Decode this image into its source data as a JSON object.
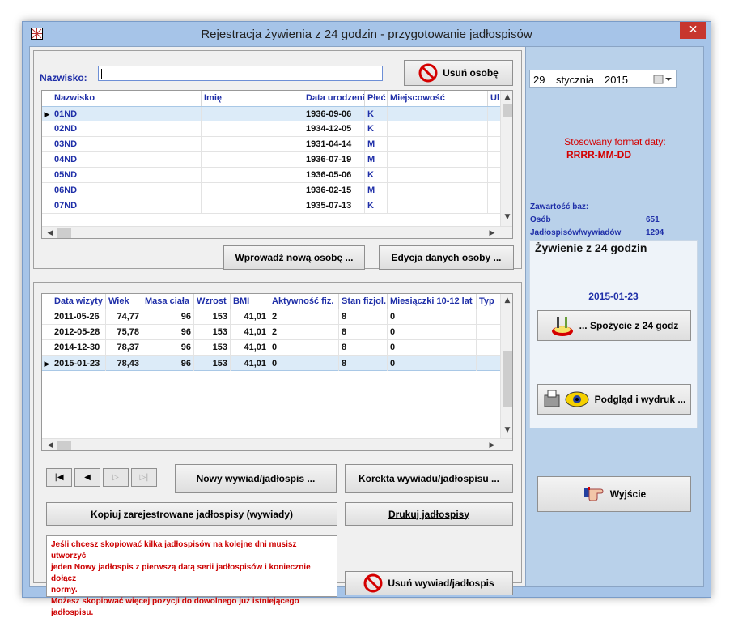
{
  "window": {
    "title": "Rejestracja żywienia z 24 godzin - przygotowanie jadłospisów",
    "close_glyph": "✕"
  },
  "search": {
    "label": "Nazwisko:",
    "value": ""
  },
  "buttons": {
    "delete_person": "Usuń osobę",
    "new_person": "Wprowadź nową osobę ...",
    "edit_person": "Edycja danych osoby ...",
    "new_interview": "Nowy wywiad/jadłospis ...",
    "correct_interview": "Korekta wywiadu/jadłospisu ...",
    "copy_interviews": "Kopiuj zarejestrowane jadłospisy (wywiady)",
    "print_menus": "Drukuj jadłospisy",
    "delete_interview": "Usuń wywiad/jadłospis",
    "intake_24h": "... Spożycie z 24 godz",
    "preview_print": "Podgląd i wydruk ...",
    "exit": "Wyjście"
  },
  "persons_grid": {
    "columns": [
      "Nazwisko",
      "Imię",
      "Data urodzenia",
      "Płeć",
      "Miejscowość",
      "Ul"
    ],
    "rows": [
      {
        "nazwisko": "01ND",
        "imie": "",
        "data": "1936-09-06",
        "plec": "K",
        "miejscowosc": ""
      },
      {
        "nazwisko": "02ND",
        "imie": "",
        "data": "1934-12-05",
        "plec": "K",
        "miejscowosc": ""
      },
      {
        "nazwisko": "03ND",
        "imie": "",
        "data": "1931-04-14",
        "plec": "M",
        "miejscowosc": ""
      },
      {
        "nazwisko": "04ND",
        "imie": "",
        "data": "1936-07-19",
        "plec": "M",
        "miejscowosc": ""
      },
      {
        "nazwisko": "05ND",
        "imie": "",
        "data": "1936-05-06",
        "plec": "K",
        "miejscowosc": ""
      },
      {
        "nazwisko": "06ND",
        "imie": "",
        "data": "1936-02-15",
        "plec": "M",
        "miejscowosc": ""
      },
      {
        "nazwisko": "07ND",
        "imie": "",
        "data": "1935-07-13",
        "plec": "K",
        "miejscowosc": ""
      }
    ],
    "selected_index": 0
  },
  "visits_grid": {
    "columns": [
      "Data wizyty",
      "Wiek",
      "Masa ciała",
      "Wzrost",
      "BMI",
      "Aktywność fiz.",
      "Stan fizjol.",
      "Miesiączki 10-12 lat",
      "Typ"
    ],
    "rows": [
      {
        "data": "2011-05-26",
        "wiek": "74,77",
        "masa": "96",
        "wzrost": "153",
        "bmi": "41,01",
        "aktywnosc": "2",
        "stan": "8",
        "miesiaczki": "0"
      },
      {
        "data": "2012-05-28",
        "wiek": "75,78",
        "masa": "96",
        "wzrost": "153",
        "bmi": "41,01",
        "aktywnosc": "2",
        "stan": "8",
        "miesiaczki": "0"
      },
      {
        "data": "2014-12-30",
        "wiek": "78,37",
        "masa": "96",
        "wzrost": "153",
        "bmi": "41,01",
        "aktywnosc": "0",
        "stan": "8",
        "miesiaczki": "0"
      },
      {
        "data": "2015-01-23",
        "wiek": "78,43",
        "masa": "96",
        "wzrost": "153",
        "bmi": "41,01",
        "aktywnosc": "0",
        "stan": "8",
        "miesiaczki": "0"
      }
    ],
    "selected_index": 3
  },
  "note": {
    "lines": [
      "Jeśli chcesz skopiować kilka jadłospisów na kolejne dni musisz utworzyć",
      "jeden Nowy jadłospis z pierwszą datą serii jadłospisów i koniecznie dołącz",
      "normy.",
      "Możesz skopiować więcej pozycji do dowolnego już istniejącego jadłospisu."
    ]
  },
  "right": {
    "date": {
      "day": "29",
      "month": "stycznia",
      "year": "2015"
    },
    "format_label": "Stosowany format daty:",
    "format_value": "RRRR-MM-DD",
    "db_heading": "Zawartość baz:",
    "persons_label": "Osób",
    "persons_count": "651",
    "menus_label": "Jadłospisów/wywiadów",
    "menus_count": "1294",
    "section_title": "Żywienie z 24 godzin",
    "current_date": "2015-01-23"
  },
  "colors": {
    "header_blue": "#1f2fa8",
    "note_red": "#cc0000",
    "panel_blue": "#b9d1ea",
    "close_red": "#c7362e"
  },
  "icons": [
    "app-icon",
    "no-entry-icon",
    "food-plate-icon",
    "printer-eye-icon",
    "pointing-hand-icon",
    "calendar-icon",
    "nav-first-icon",
    "nav-prev-icon",
    "nav-next-icon",
    "nav-last-icon"
  ]
}
